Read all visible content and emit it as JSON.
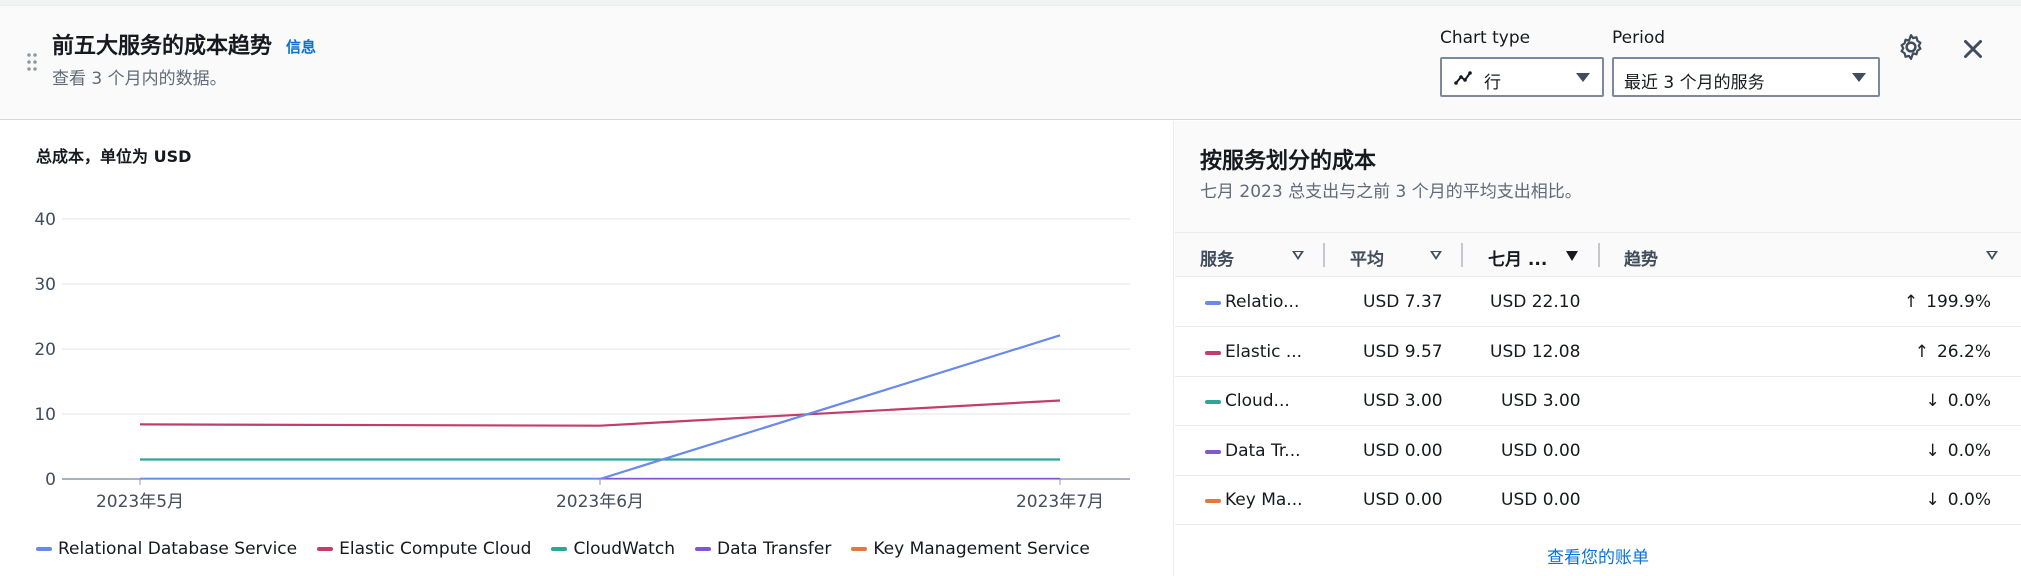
{
  "header": {
    "title": "前五大服务的成本趋势",
    "info_link": "信息",
    "subtitle": "查看 3 个月内的数据。",
    "chart_type_label": "Chart type",
    "chart_type_value": "行",
    "period_label": "Period",
    "period_value": "最近 3 个月的服务"
  },
  "icons": {
    "drag": "drag-handle-icon",
    "chart_type": "line-chart-icon",
    "settings": "gear-icon",
    "close": "close-icon"
  },
  "chart_data": {
    "type": "line",
    "title": "总成本，单位为 USD",
    "x": [
      "2023年5月",
      "2023年6月",
      "2023年7月"
    ],
    "ylim": [
      0,
      40
    ],
    "yticks": [
      0,
      10,
      20,
      30,
      40
    ],
    "grid": true,
    "legend_position": "bottom",
    "series": [
      {
        "name": "Relational Database Service",
        "color": "#688ae8",
        "values": [
          0,
          0,
          22.1
        ]
      },
      {
        "name": "Elastic Compute Cloud",
        "color": "#c33d69",
        "values": [
          8.4,
          8.2,
          12.08
        ]
      },
      {
        "name": "CloudWatch",
        "color": "#2ea597",
        "values": [
          3.0,
          3.0,
          3.0
        ]
      },
      {
        "name": "Data Transfer",
        "color": "#8456ce",
        "values": [
          0,
          0,
          0
        ]
      },
      {
        "name": "Key Management Service",
        "color": "#e07941",
        "values": [
          0,
          0,
          0
        ]
      }
    ]
  },
  "breakdown": {
    "title": "按服务划分的成本",
    "subtitle": "七月 2023 总支出与之前 3 个月的平均支出相比。",
    "columns": [
      "服务",
      "平均",
      "七月 ...",
      "趋势"
    ],
    "rows": [
      {
        "service": "Relatio...",
        "avg": "USD 7.37",
        "month": "USD 22.10",
        "arrow": "↑",
        "trend": "199.9%",
        "color": "#688ae8"
      },
      {
        "service": "Elastic ...",
        "avg": "USD 9.57",
        "month": "USD 12.08",
        "arrow": "↑",
        "trend": "26.2%",
        "color": "#c33d69"
      },
      {
        "service": "Cloud...",
        "avg": "USD 3.00",
        "month": "USD 3.00",
        "arrow": "↓",
        "trend": "0.0%",
        "color": "#2ea597"
      },
      {
        "service": "Data Tr...",
        "avg": "USD 0.00",
        "month": "USD 0.00",
        "arrow": "↓",
        "trend": "0.0%",
        "color": "#8456ce"
      },
      {
        "service": "Key Ma...",
        "avg": "USD 0.00",
        "month": "USD 0.00",
        "arrow": "↓",
        "trend": "0.0%",
        "color": "#e07941"
      }
    ],
    "view_bill_link": "查看您的账单"
  }
}
